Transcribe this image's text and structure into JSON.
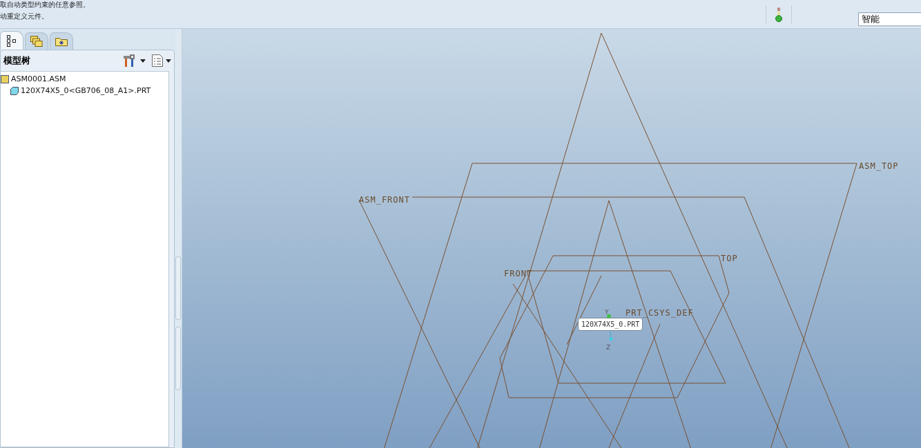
{
  "message_lines": [
    "取自动类型约束的任意参照。",
    "动重定义元件。"
  ],
  "filter": {
    "value": "智能"
  },
  "navigator_tabs": [
    {
      "kind": "tree",
      "selected": true
    },
    {
      "kind": "layers",
      "selected": false
    },
    {
      "kind": "favorites",
      "selected": false
    }
  ],
  "model_tree": {
    "title": "模型树",
    "items": [
      {
        "label": "ASM0001.ASM",
        "kind": "assembly",
        "children": [
          {
            "label": "120X74X5_0<GB706_08_A1>.PRT",
            "kind": "part"
          }
        ]
      }
    ]
  },
  "viewport": {
    "datum_labels": [
      "ASM_TOP",
      "ASM_FRONT",
      "TOP",
      "FRONT",
      "PRT_CSYS_DEF"
    ],
    "axis_labels": [
      "Y",
      "Z"
    ],
    "tooltip": "120X74X5_0.PRT"
  }
}
